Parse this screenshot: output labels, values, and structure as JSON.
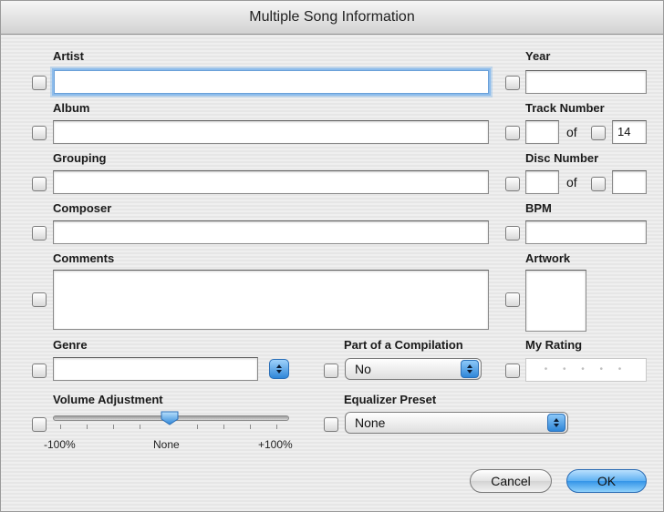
{
  "window": {
    "title": "Multiple Song Information"
  },
  "fields": {
    "artist": {
      "label": "Artist",
      "value": ""
    },
    "album": {
      "label": "Album",
      "value": ""
    },
    "grouping": {
      "label": "Grouping",
      "value": ""
    },
    "composer": {
      "label": "Composer",
      "value": ""
    },
    "comments": {
      "label": "Comments",
      "value": ""
    },
    "genre": {
      "label": "Genre",
      "value": ""
    },
    "year": {
      "label": "Year",
      "value": ""
    },
    "track_number": {
      "label": "Track Number",
      "number": "",
      "of_label": "of",
      "total": "14"
    },
    "disc_number": {
      "label": "Disc Number",
      "number": "",
      "of_label": "of",
      "total": ""
    },
    "bpm": {
      "label": "BPM",
      "value": ""
    },
    "artwork": {
      "label": "Artwork"
    },
    "compilation": {
      "label": "Part of a Compilation",
      "value": "No"
    },
    "rating": {
      "label": "My Rating",
      "value": "• • • • •"
    },
    "volume": {
      "label": "Volume Adjustment",
      "min_label": "-100%",
      "mid_label": "None",
      "max_label": "+100%",
      "level": 0
    },
    "equalizer": {
      "label": "Equalizer Preset",
      "value": "None"
    }
  },
  "buttons": {
    "cancel": "Cancel",
    "ok": "OK"
  },
  "colors": {
    "focus_ring": "#8cbcec",
    "accent_blue": "#3495e8"
  }
}
